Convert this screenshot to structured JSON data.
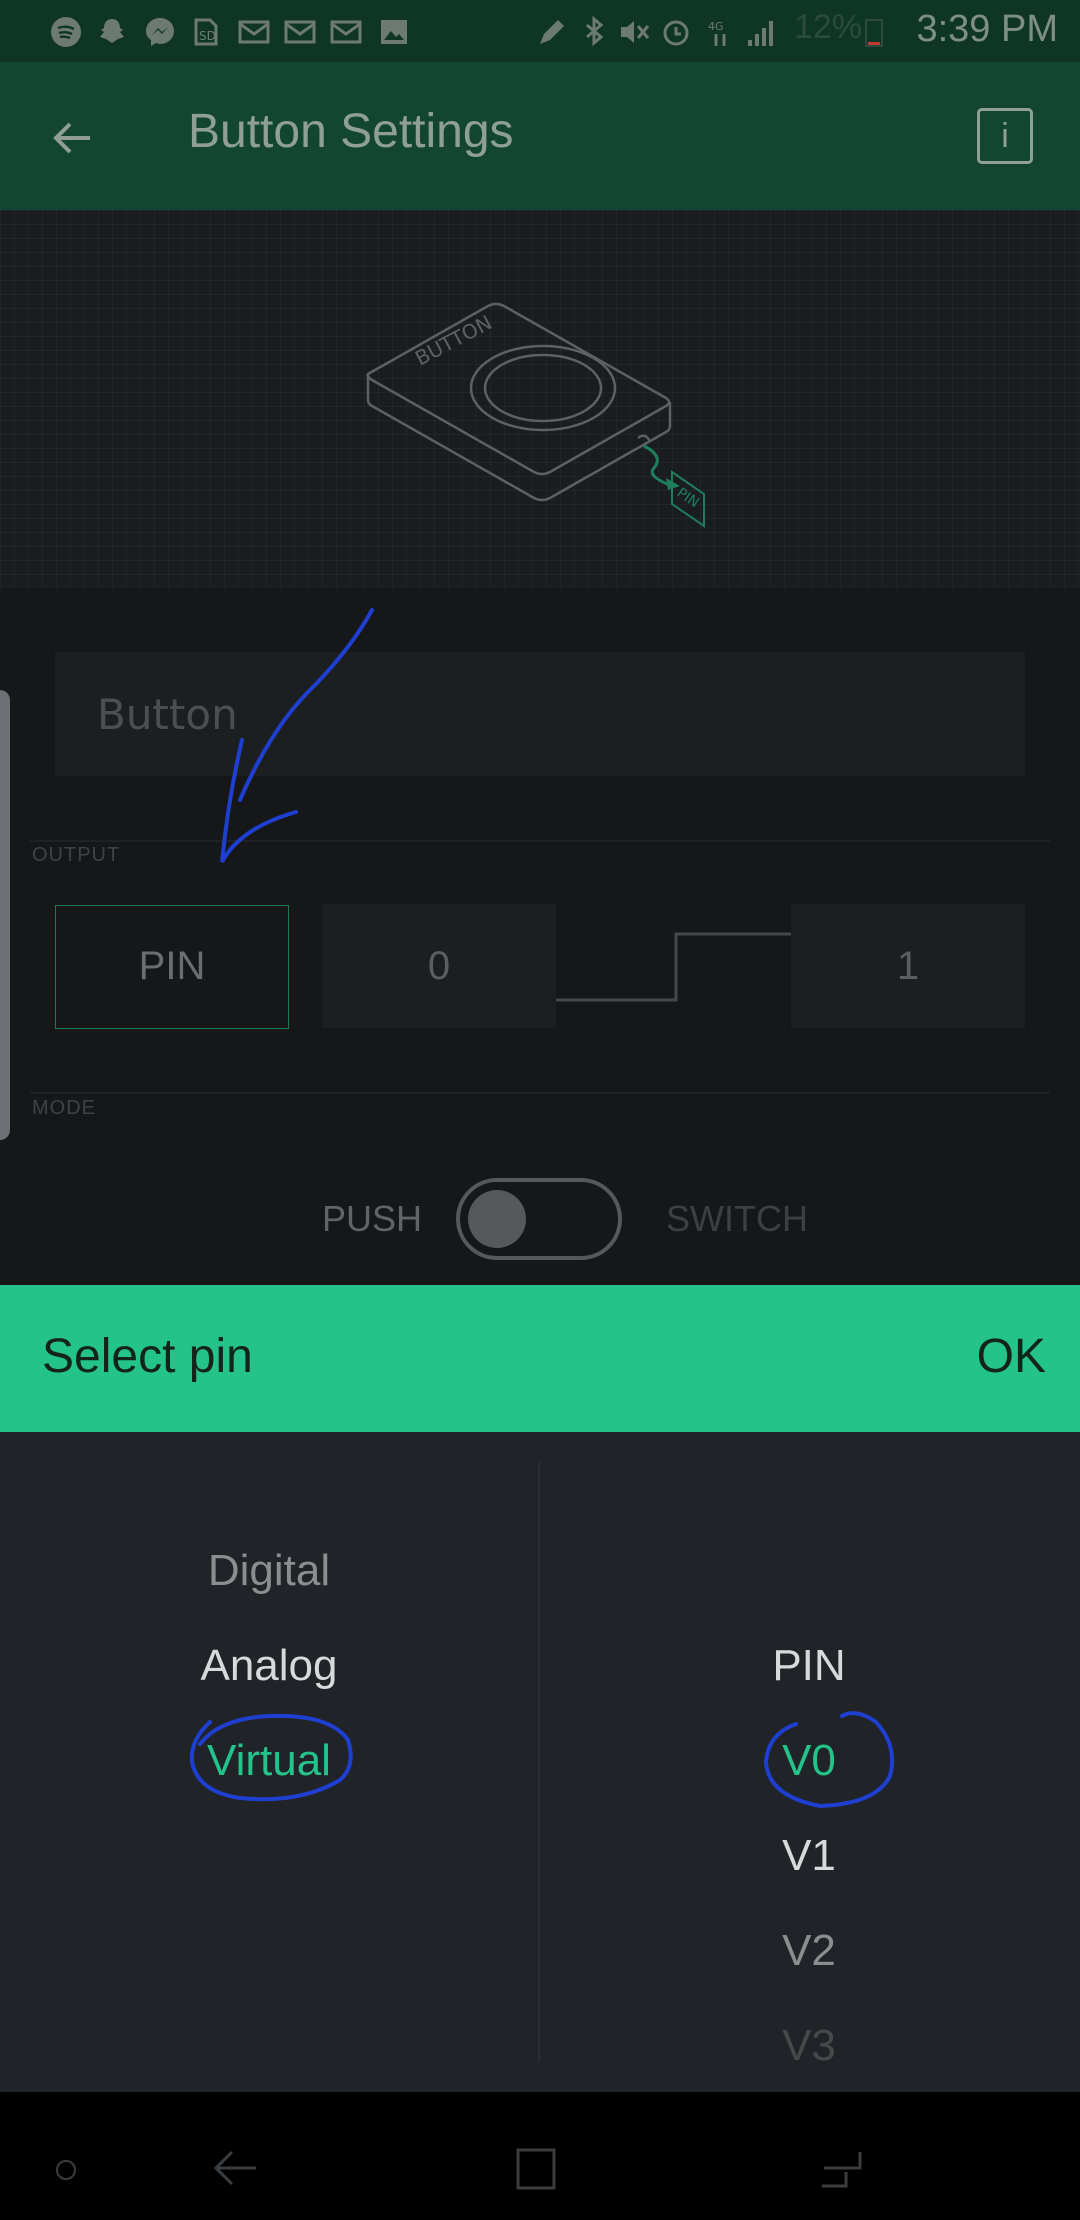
{
  "status_bar": {
    "time": "3:39 PM",
    "battery": "12%",
    "icons": [
      "spotify-icon",
      "snapchat-icon",
      "messenger-icon",
      "sd-card-icon",
      "mail-icon",
      "mail-icon",
      "mail-icon",
      "image-icon",
      "pen-icon",
      "bluetooth-icon",
      "mute-icon",
      "alarm-icon",
      "data-icon",
      "signal-icon",
      "battery-icon"
    ]
  },
  "app_bar": {
    "back_icon": "arrow-left-icon",
    "title": "Button Settings",
    "info_icon": "info-icon",
    "info_label": "i"
  },
  "preview": {
    "device_label": "BUTTON",
    "pin_label": "PIN"
  },
  "form": {
    "name_placeholder": "Button",
    "output_label": "OUTPUT",
    "pin_button": "PIN",
    "low_value": "0",
    "high_value": "1",
    "mode_label": "MODE",
    "mode_push": "PUSH",
    "mode_switch": "SWITCH"
  },
  "sheet": {
    "title": "Select pin",
    "ok": "OK"
  },
  "picker": {
    "types": [
      "Digital",
      "Analog",
      "Virtual"
    ],
    "selected_type": "Virtual",
    "pins": [
      "PIN",
      "V0",
      "V1",
      "V2",
      "V3"
    ],
    "selected_pin": "V0"
  },
  "colors": {
    "accent": "#24c38b",
    "app_bar": "#124632",
    "annotation": "#1f3fd1"
  }
}
